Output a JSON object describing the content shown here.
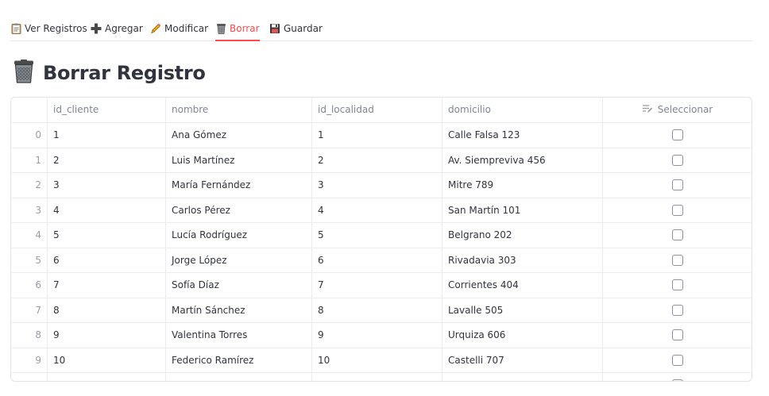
{
  "tabs": [
    {
      "label": "Ver Registros",
      "icon": "clipboard-icon"
    },
    {
      "label": "Agregar",
      "icon": "plus-icon"
    },
    {
      "label": "Modificar",
      "icon": "pencil-icon"
    },
    {
      "label": "Borrar",
      "icon": "trash-icon"
    },
    {
      "label": "Guardar",
      "icon": "floppy-disk-icon"
    }
  ],
  "active_tab": "Borrar",
  "accent_color": "#ff4b4b",
  "page": {
    "title": "Borrar Registro",
    "title_icon": "trash-can-icon"
  },
  "table": {
    "columns": [
      "id_cliente",
      "nombre",
      "id_localidad",
      "domicilio",
      "Seleccionar"
    ],
    "select_column_icon": "edit-list-icon",
    "rows": [
      {
        "index": "0",
        "id_cliente": "1",
        "nombre": "Ana Gómez",
        "id_localidad": "1",
        "domicilio": "Calle Falsa 123",
        "selected": false
      },
      {
        "index": "1",
        "id_cliente": "2",
        "nombre": "Luis Martínez",
        "id_localidad": "2",
        "domicilio": "Av. Siempreviva 456",
        "selected": false
      },
      {
        "index": "2",
        "id_cliente": "3",
        "nombre": "María Fernández",
        "id_localidad": "3",
        "domicilio": "Mitre 789",
        "selected": false
      },
      {
        "index": "3",
        "id_cliente": "4",
        "nombre": "Carlos Pérez",
        "id_localidad": "4",
        "domicilio": "San Martín 101",
        "selected": false
      },
      {
        "index": "4",
        "id_cliente": "5",
        "nombre": "Lucía Rodríguez",
        "id_localidad": "5",
        "domicilio": "Belgrano 202",
        "selected": false
      },
      {
        "index": "5",
        "id_cliente": "6",
        "nombre": "Jorge López",
        "id_localidad": "6",
        "domicilio": "Rivadavia 303",
        "selected": false
      },
      {
        "index": "6",
        "id_cliente": "7",
        "nombre": "Sofía Díaz",
        "id_localidad": "7",
        "domicilio": "Corrientes 404",
        "selected": false
      },
      {
        "index": "7",
        "id_cliente": "8",
        "nombre": "Martín Sánchez",
        "id_localidad": "8",
        "domicilio": "Lavalle 505",
        "selected": false
      },
      {
        "index": "8",
        "id_cliente": "9",
        "nombre": "Valentina Torres",
        "id_localidad": "9",
        "domicilio": "Urquiza 606",
        "selected": false
      },
      {
        "index": "9",
        "id_cliente": "10",
        "nombre": "Federico Ramírez",
        "id_localidad": "10",
        "domicilio": "Castelli 707",
        "selected": false
      }
    ]
  }
}
